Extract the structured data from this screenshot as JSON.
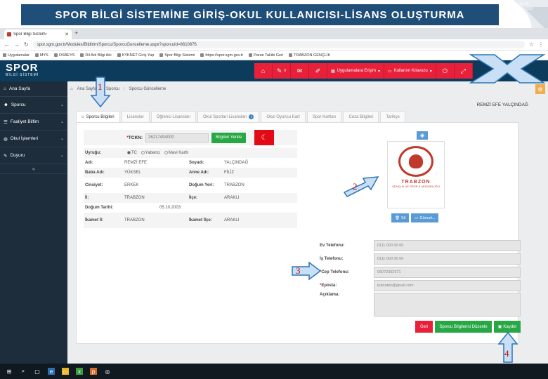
{
  "slide": {
    "title": "SPOR BİLGİ SİSTEMİNE GİRİŞ-OKUL KULLANICISI-LİSANS OLUŞTURMA"
  },
  "browser": {
    "tab_title": "Spor Bilgi Sistemi",
    "url": "spor.sgm.gov.tr/Modules/Bildirim/Sporcu/SporcuGuncelleme.aspx?sporcuId=8610676",
    "bookmarks": [
      "Uygulamalar",
      "MYS",
      "OSBEYS",
      "Dil Adı Bilgi Adı",
      "KYKNET Giriş Yap",
      "Spor Bilgi Sistemi",
      "https://spor.sgm.gov.tr",
      "Paran Takibi Geri",
      "TRABZON GENÇLİK"
    ]
  },
  "app": {
    "logo_main": "SPOR",
    "logo_sub": "BİLGİ SİSTEMİ",
    "badge_count": "0",
    "nav": {
      "applications": "Uygulamalara Erişim",
      "manual": "Kullanım Kılavuzu"
    }
  },
  "sidebar": {
    "items": [
      {
        "label": "Ana Sayfa"
      },
      {
        "label": "Sporcu"
      },
      {
        "label": "Faaliyet Bilfim"
      },
      {
        "label": "Okul İşlemleri"
      },
      {
        "label": "Duyuru"
      }
    ]
  },
  "breadcrumb": [
    "Ana Sayfa",
    "Sporcu",
    "Sporcu Güncelleme"
  ],
  "person_name": "REMZİ EFE YALÇINDAĞ",
  "tabs": [
    "Sporcu Bilgileri",
    "Lisanslar",
    "Öğrenci Lisansları",
    "Okul Sporları Lisansları",
    "Okul Oyuncu Kart",
    "Spor Kartları",
    "Ceza Bilgileri",
    "Tarihçe"
  ],
  "form": {
    "tckn_label": "TCKN:",
    "tckn_value": "26217494000",
    "refresh_button": "Bilgileri Yenile",
    "nationality_label": "Uyruğu:",
    "nationality_options": [
      "TC",
      "Yabancı",
      "Mavi Kartlı"
    ],
    "rows": [
      {
        "k": "Adı:",
        "v": "REMZİ EFE",
        "k2": "Soyadı:",
        "v2": "YALÇINDAĞ"
      },
      {
        "k": "Baba Adı:",
        "v": "YÜKSEL",
        "k2": "Anne Adı:",
        "v2": "FİLİZ"
      },
      {
        "k": "Cinsiyet:",
        "v": "ERKEK",
        "k2": "Doğum Yeri:",
        "v2": "TRABZON"
      },
      {
        "k": "İl:",
        "v": "TRABZON",
        "k2": "İlçe:",
        "v2": "ARAKLI"
      },
      {
        "k": "Doğum Tarihi:",
        "v": "05.10.2003",
        "k2": "",
        "v2": ""
      },
      {
        "k": "İkamet İl:",
        "v": "TRABZON",
        "k2": "İkamet İlçe:",
        "v2": "ARAKLI"
      }
    ],
    "photo_city": "TRABZON",
    "photo_sub": "GENÇLİK VE SPOR İL MÜDÜRLÜĞÜ",
    "delete_button": "Sil",
    "upload_button": "Güncel...",
    "contact": {
      "home_phone_label": "Ev Telefonu:",
      "home_phone_value": "0111 000 00 00",
      "work_phone_label": "İş Telefonu:",
      "work_phone_value": "0111 000 00 00",
      "mobile_label": "Cep Telefonu:",
      "mobile_value": "05072362671",
      "email_label": "Eposta:",
      "email_value": "kubratek@gmail.com",
      "notes_label": "Açıklama:",
      "notes_value": ""
    },
    "buttons": {
      "back": "Geri",
      "edit": "Sporcu Bilgilerini Düzenle",
      "save": "Kaydet"
    }
  },
  "annotations": [
    "1",
    "2",
    "3",
    "4"
  ],
  "taskbar": {
    "time": "15:29",
    "date": "23.11.2019"
  }
}
